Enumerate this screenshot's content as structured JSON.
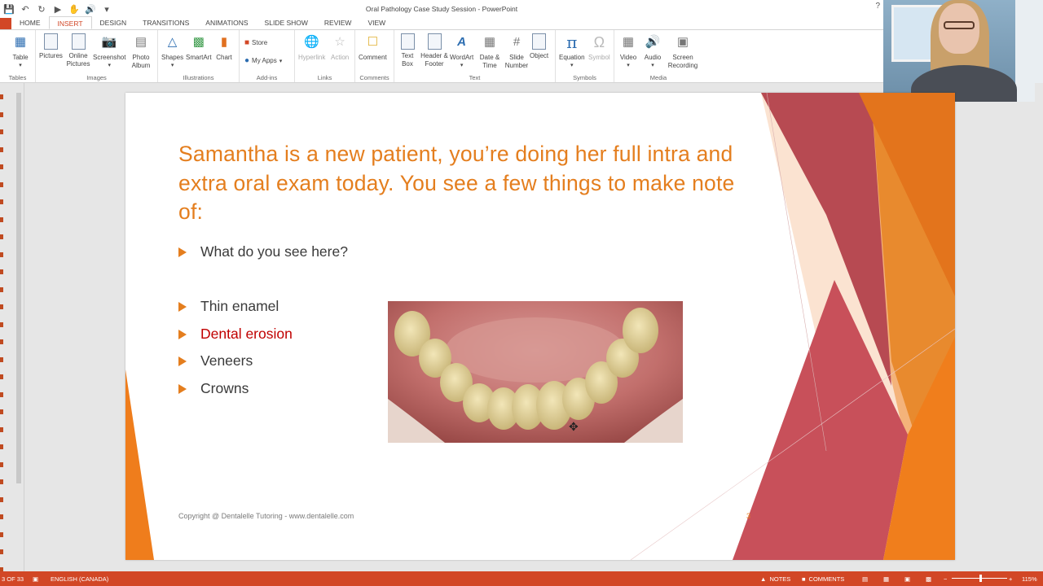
{
  "window": {
    "title": "Oral Pathology Case Study Session - PowerPoint"
  },
  "tabs": [
    {
      "label": "HOME",
      "active": false
    },
    {
      "label": "INSERT",
      "active": true
    },
    {
      "label": "DESIGN",
      "active": false
    },
    {
      "label": "TRANSITIONS",
      "active": false
    },
    {
      "label": "ANIMATIONS",
      "active": false
    },
    {
      "label": "SLIDE SHOW",
      "active": false
    },
    {
      "label": "REVIEW",
      "active": false
    },
    {
      "label": "VIEW",
      "active": false
    }
  ],
  "ribbon": {
    "tables": {
      "label": "Tables",
      "table": "Table"
    },
    "images": {
      "label": "Images",
      "pictures": "Pictures",
      "online_pictures": "Online Pictures",
      "screenshot": "Screenshot",
      "photo_album": "Photo Album"
    },
    "illustrations": {
      "label": "Illustrations",
      "shapes": "Shapes",
      "smartart": "SmartArt",
      "chart": "Chart"
    },
    "addins": {
      "label": "Add-ins",
      "store": "Store",
      "my_apps": "My Apps"
    },
    "links": {
      "label": "Links",
      "hyperlink": "Hyperlink",
      "action": "Action"
    },
    "comments": {
      "label": "Comments",
      "comment": "Comment"
    },
    "text": {
      "label": "Text",
      "text_box": "Text Box",
      "header_footer": "Header & Footer",
      "wordart": "WordArt",
      "date_time": "Date & Time",
      "slide_number": "Slide Number",
      "object": "Object"
    },
    "symbols": {
      "label": "Symbols",
      "equation": "Equation",
      "symbol": "Symbol"
    },
    "media": {
      "label": "Media",
      "video": "Video",
      "audio": "Audio",
      "screen_recording": "Screen Recording"
    }
  },
  "slide": {
    "title": "Samantha is a new patient, you’re doing her full intra and extra oral exam today. You see a few things to make note of:",
    "question": "What do you see here?",
    "bullets": [
      "Thin enamel",
      "Dental erosion",
      "Veneers",
      "Crowns"
    ],
    "footer": "Copyright @ Dentalelle Tutoring - www.dentalelle.com",
    "page_number": "3"
  },
  "statusbar": {
    "slide_count": "3 OF 33",
    "language": "ENGLISH (CANADA)",
    "notes": "NOTES",
    "comments": "COMMENTS",
    "zoom": "115%"
  },
  "colors": {
    "accent": "#d24726",
    "title_orange": "#e47e1e",
    "highlight_red": "#c00000"
  }
}
